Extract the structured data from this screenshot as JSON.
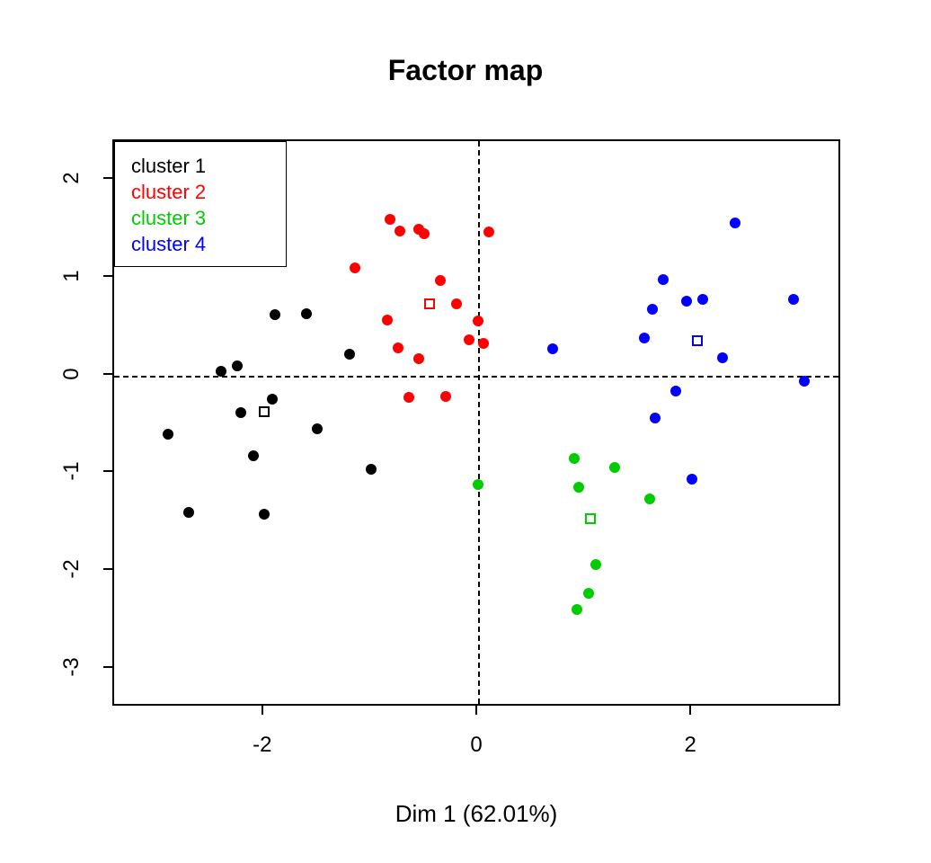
{
  "chart_data": {
    "type": "scatter",
    "title": "Factor map",
    "xlabel": "Dim 1 (62.01%)",
    "ylabel": "",
    "xlim": [
      -3.4,
      3.4
    ],
    "ylim": [
      -3.4,
      2.4
    ],
    "x_ticks": [
      -2,
      0,
      2
    ],
    "y_ticks": [
      -3,
      -2,
      -1,
      0,
      1,
      2
    ],
    "legend_position": "topleft",
    "legend": [
      {
        "label": "cluster 1",
        "color": "#000000"
      },
      {
        "label": "cluster 2",
        "color": "#FF0000"
      },
      {
        "label": "cluster 3",
        "color": "#00CC00"
      },
      {
        "label": "cluster 4",
        "color": "#0000FF"
      }
    ],
    "series": [
      {
        "name": "cluster 1",
        "color": "#000000",
        "points": [
          {
            "x": -1.9,
            "y": 0.62
          },
          {
            "x": -1.6,
            "y": 0.63
          },
          {
            "x": -2.4,
            "y": 0.04
          },
          {
            "x": -2.25,
            "y": 0.1
          },
          {
            "x": -1.92,
            "y": -0.24
          },
          {
            "x": -1.2,
            "y": 0.22
          },
          {
            "x": -2.22,
            "y": -0.38
          },
          {
            "x": -2.9,
            "y": -0.6
          },
          {
            "x": -2.1,
            "y": -0.82
          },
          {
            "x": -1.5,
            "y": -0.55
          },
          {
            "x": -1.0,
            "y": -0.96
          },
          {
            "x": -2.7,
            "y": -1.4
          },
          {
            "x": -2.0,
            "y": -1.42
          }
        ],
        "centroid": {
          "x": -2.0,
          "y": -0.37
        }
      },
      {
        "name": "cluster 2",
        "color": "#FF0000",
        "points": [
          {
            "x": -0.82,
            "y": 1.6
          },
          {
            "x": -0.73,
            "y": 1.48
          },
          {
            "x": -0.55,
            "y": 1.5
          },
          {
            "x": -0.5,
            "y": 1.45
          },
          {
            "x": -1.15,
            "y": 1.1
          },
          {
            "x": 0.1,
            "y": 1.47
          },
          {
            "x": -0.35,
            "y": 0.97
          },
          {
            "x": -0.2,
            "y": 0.73
          },
          {
            "x": -0.85,
            "y": 0.57
          },
          {
            "x": 0.0,
            "y": 0.56
          },
          {
            "x": 0.05,
            "y": 0.33
          },
          {
            "x": -0.08,
            "y": 0.37
          },
          {
            "x": -0.75,
            "y": 0.28
          },
          {
            "x": -0.55,
            "y": 0.17
          },
          {
            "x": -0.65,
            "y": -0.22
          },
          {
            "x": -0.3,
            "y": -0.21
          }
        ],
        "centroid": {
          "x": -0.45,
          "y": 0.73
        }
      },
      {
        "name": "cluster 3",
        "color": "#00CC00",
        "points": [
          {
            "x": 0.0,
            "y": -1.12
          },
          {
            "x": 0.9,
            "y": -0.85
          },
          {
            "x": 1.28,
            "y": -0.94
          },
          {
            "x": 0.94,
            "y": -1.14
          },
          {
            "x": 1.6,
            "y": -1.26
          },
          {
            "x": 1.1,
            "y": -1.94
          },
          {
            "x": 1.03,
            "y": -2.23
          },
          {
            "x": 0.92,
            "y": -2.4
          }
        ],
        "centroid": {
          "x": 1.05,
          "y": -1.47
        }
      },
      {
        "name": "cluster 4",
        "color": "#0000FF",
        "points": [
          {
            "x": 2.4,
            "y": 1.56
          },
          {
            "x": 1.73,
            "y": 0.98
          },
          {
            "x": 1.95,
            "y": 0.76
          },
          {
            "x": 1.63,
            "y": 0.68
          },
          {
            "x": 2.1,
            "y": 0.78
          },
          {
            "x": 2.95,
            "y": 0.78
          },
          {
            "x": 0.7,
            "y": 0.27
          },
          {
            "x": 1.55,
            "y": 0.38
          },
          {
            "x": 2.28,
            "y": 0.18
          },
          {
            "x": 1.85,
            "y": -0.16
          },
          {
            "x": 3.05,
            "y": -0.06
          },
          {
            "x": 1.65,
            "y": -0.44
          },
          {
            "x": 2.0,
            "y": -1.06
          }
        ],
        "centroid": {
          "x": 2.05,
          "y": 0.36
        }
      }
    ]
  }
}
